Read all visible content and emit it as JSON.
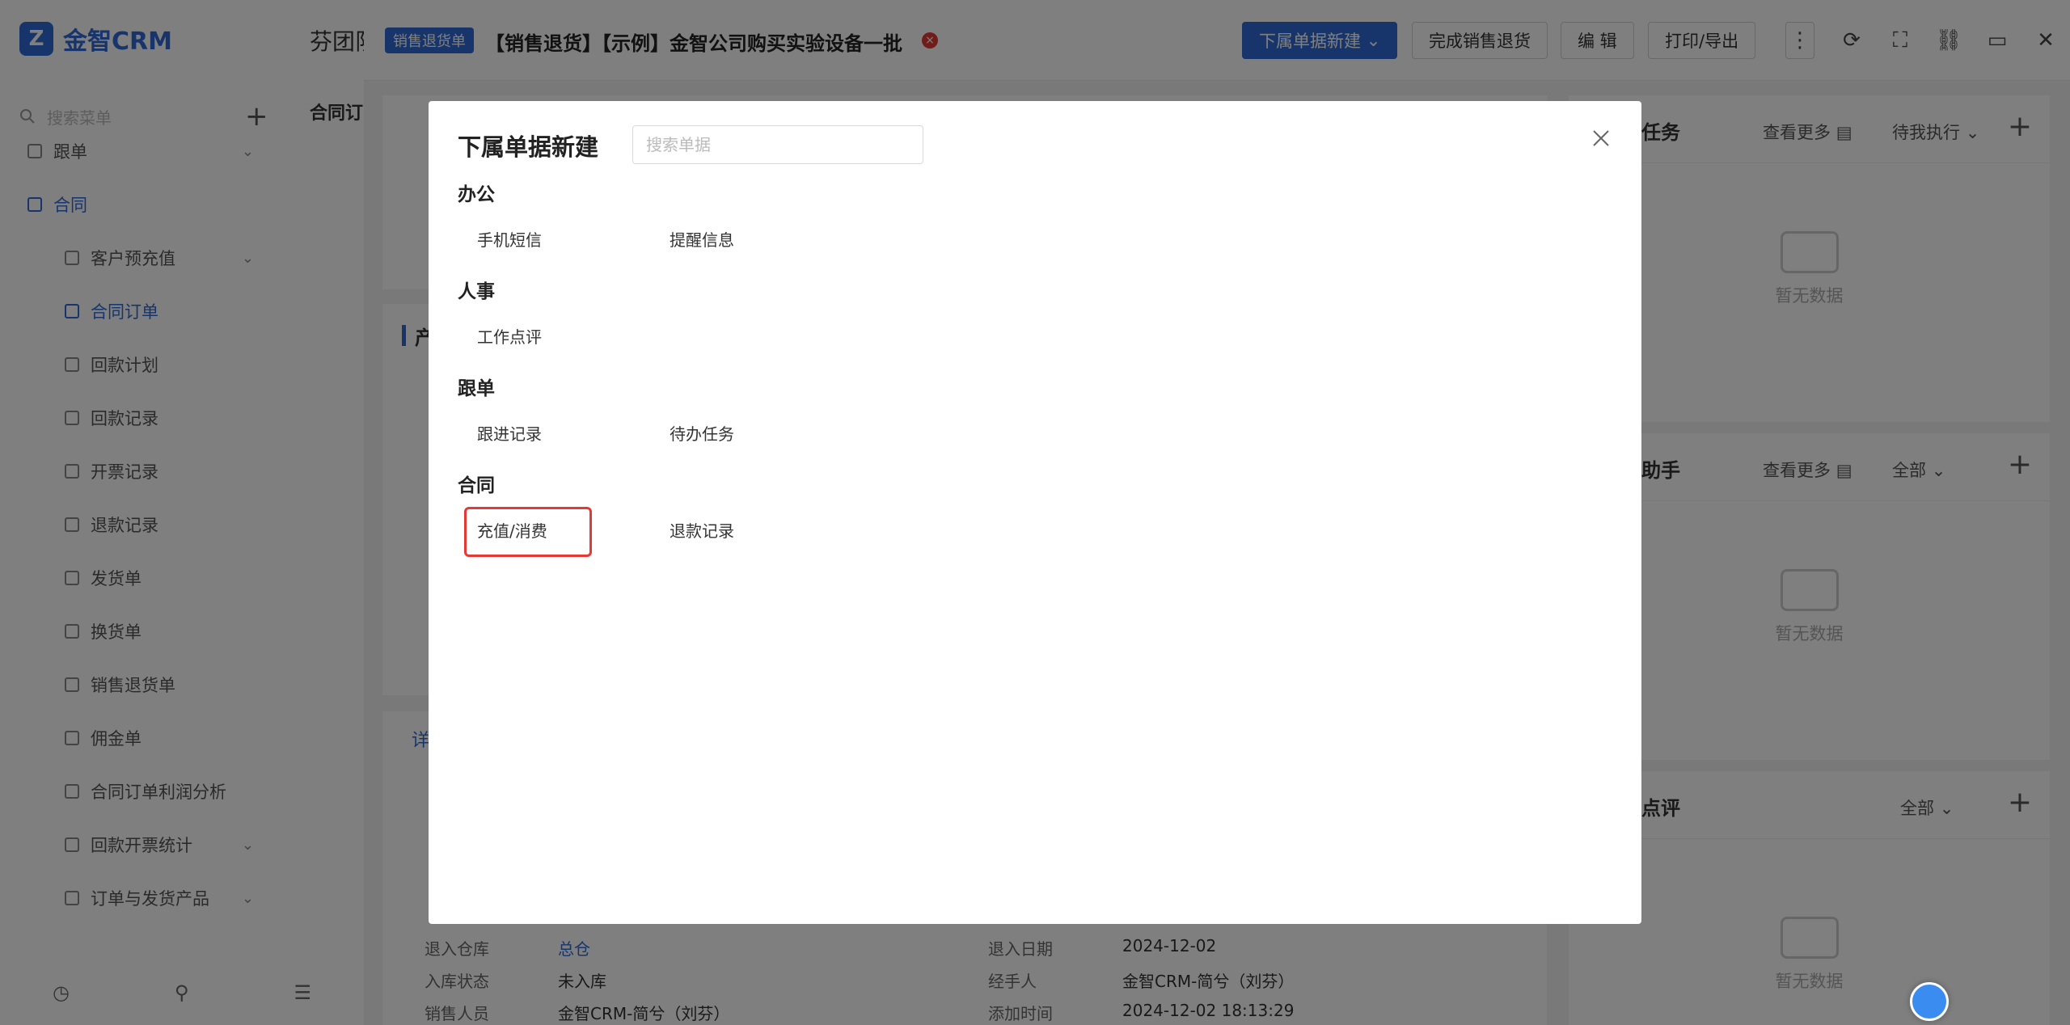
{
  "sidebar": {
    "logo_text": "金智CRM",
    "search_placeholder": "搜索菜单",
    "items": [
      {
        "label": "跟单",
        "level": "top",
        "chev": "⌄"
      },
      {
        "label": "合同",
        "level": "top",
        "active": true
      },
      {
        "label": "客户预充值",
        "level": "sub",
        "chev": "⌄"
      },
      {
        "label": "合同订单",
        "level": "sub",
        "active": true
      },
      {
        "label": "回款计划",
        "level": "sub"
      },
      {
        "label": "回款记录",
        "level": "sub"
      },
      {
        "label": "开票记录",
        "level": "sub"
      },
      {
        "label": "退款记录",
        "level": "sub"
      },
      {
        "label": "发货单",
        "level": "sub"
      },
      {
        "label": "换货单",
        "level": "sub"
      },
      {
        "label": "销售退货单",
        "level": "sub"
      },
      {
        "label": "佣金单",
        "level": "sub"
      },
      {
        "label": "合同订单利润分析",
        "level": "sub"
      },
      {
        "label": "回款开票统计",
        "level": "sub",
        "chev": "⌄"
      },
      {
        "label": "订单与发货产品",
        "level": "sub",
        "chev": "⌄"
      }
    ]
  },
  "main": {
    "header_title": "芬团队",
    "subtitle": "合同订",
    "card_b_title": "产",
    "tab_label": "详",
    "fields": [
      {
        "label": "退入仓库",
        "value": "总仓",
        "link": true,
        "label2": "退入日期",
        "value2": "2024-12-02"
      },
      {
        "label": "入库状态",
        "value": "未入库",
        "label2": "经手人",
        "value2": "金智CRM-简兮（刘芬）"
      },
      {
        "label": "销售人员",
        "value": "金智CRM-简兮（刘芬）",
        "label2": "添加时间",
        "value2": "2024-12-02 18:13:29"
      }
    ]
  },
  "topbar": {
    "badge": "销售退货单",
    "title": "【销售退货】【示例】金智公司购买实验设备一批",
    "buttons": {
      "new_sub": "下属单据新建",
      "complete": "完成销售退货",
      "edit": "编 辑",
      "print": "打印/导出"
    }
  },
  "right_panel": {
    "cards": [
      {
        "title": "任务",
        "more": "查看更多",
        "filter": "待我执行",
        "empty": "暂无数据"
      },
      {
        "title": "助手",
        "more": "查看更多",
        "filter": "全部",
        "empty": "暂无数据"
      },
      {
        "title": "点评",
        "filter": "全部",
        "empty": "暂无数据"
      }
    ]
  },
  "modal": {
    "title": "下属单据新建",
    "search_placeholder": "搜索单据",
    "groups": [
      {
        "title": "办公",
        "items": [
          "手机短信",
          "提醒信息"
        ]
      },
      {
        "title": "人事",
        "items": [
          "工作点评"
        ]
      },
      {
        "title": "跟单",
        "items": [
          "跟进记录",
          "待办任务"
        ]
      },
      {
        "title": "合同",
        "items": [
          "充值/消费",
          "退款记录"
        ],
        "highlight_index": 0
      }
    ]
  }
}
